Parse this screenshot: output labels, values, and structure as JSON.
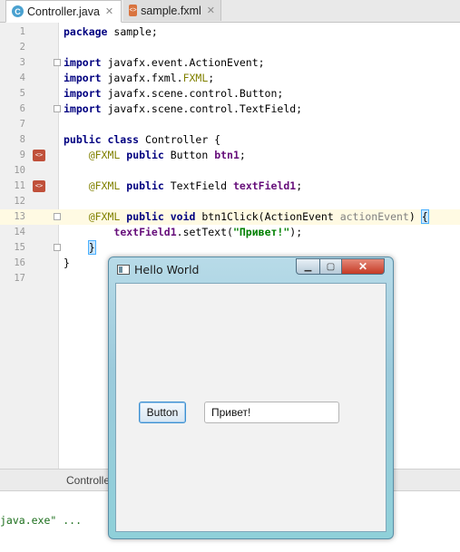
{
  "tabs": [
    {
      "label": "Controller.java",
      "icon": "java-class-icon",
      "active": true
    },
    {
      "label": "sample.fxml",
      "icon": "fxml-file-icon",
      "active": false
    }
  ],
  "lines": [
    {
      "n": "1"
    },
    {
      "n": "2"
    },
    {
      "n": "3"
    },
    {
      "n": "4"
    },
    {
      "n": "5"
    },
    {
      "n": "6"
    },
    {
      "n": "7"
    },
    {
      "n": "8"
    },
    {
      "n": "9"
    },
    {
      "n": "10"
    },
    {
      "n": "11"
    },
    {
      "n": "12"
    },
    {
      "n": "13"
    },
    {
      "n": "14"
    },
    {
      "n": "15"
    },
    {
      "n": "16"
    },
    {
      "n": "17"
    }
  ],
  "code": {
    "l1_kw": "package",
    "l1_rest": " sample;",
    "l3_kw": "import",
    "l3_rest": " javafx.event.ActionEvent;",
    "l4_kw": "import",
    "l4_rest": " javafx.fxml.",
    "l4_ann": "FXML",
    "l4_end": ";",
    "l5_kw": "import",
    "l5_rest": " javafx.scene.control.Button;",
    "l6_kw": "import",
    "l6_rest": " javafx.scene.control.TextField;",
    "l8_kw": "public class",
    "l8_rest": " Controller {",
    "l9_ann": "@FXML",
    "l9_kw": "public",
    "l9_type": " Button ",
    "l9_field": "btn1",
    "l9_end": ";",
    "l11_ann": "@FXML",
    "l11_kw": "public",
    "l11_type": " TextField ",
    "l11_field": "textField1",
    "l11_end": ";",
    "l13_ann": "@FXML",
    "l13_kw": "public void",
    "l13_method": " btn1Click(ActionEvent ",
    "l13_param": "actionEvent",
    "l13_close": ") ",
    "l13_brace": "{",
    "l14_field": "textField1",
    "l14_call": ".setText(",
    "l14_str": "\"Привет!\"",
    "l14_end": ");",
    "l15_brace": "}",
    "l16_brace": "}"
  },
  "bottom_tab": "Controller",
  "console_text": "java.exe\" ...",
  "window": {
    "title": "Hello World",
    "min_symbol": "▁",
    "max_symbol": "▢",
    "close_symbol": "✕",
    "button_label": "Button",
    "field_value": "Привет!"
  },
  "colors": {
    "keyword": "#000080",
    "annotation": "#808000",
    "string": "#008000",
    "field": "#660e7a",
    "caret_line": "#fffae3"
  }
}
